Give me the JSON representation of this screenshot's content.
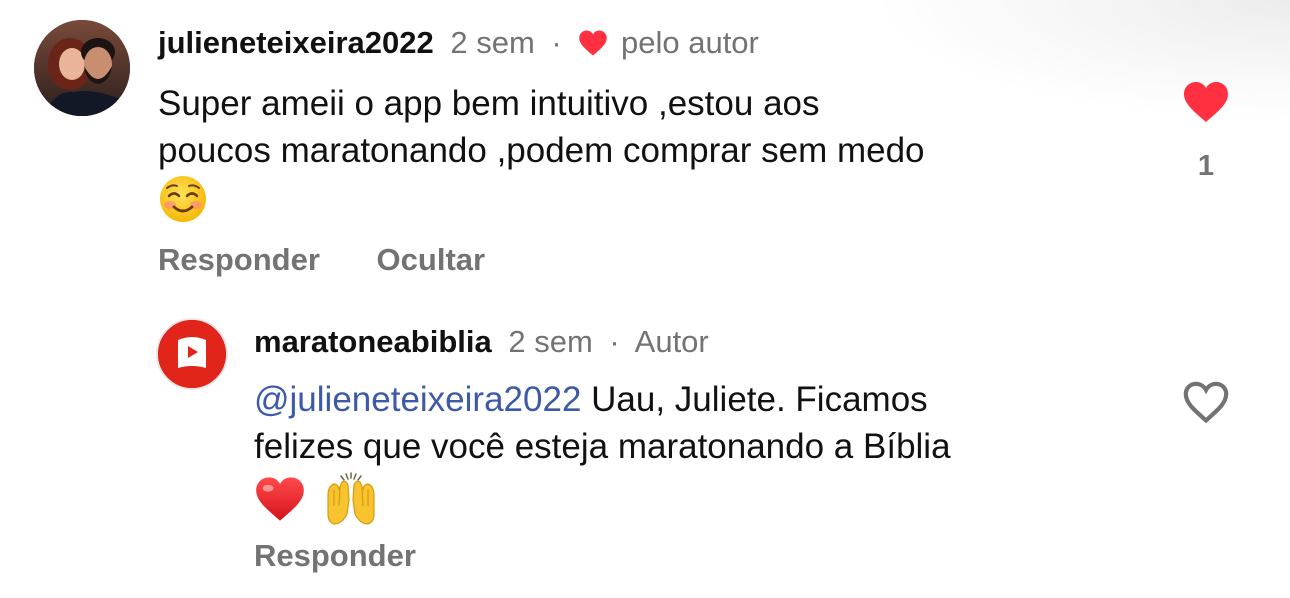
{
  "comments": [
    {
      "username": "julieneteixeira2022",
      "time": "2 sem",
      "separator": "·",
      "liked_by_author_label": "pelo autor",
      "text_line1": "Super ameii o app bem intuitivo ,estou aos",
      "text_line2": "poucos maratonando ,podem comprar sem medo",
      "emoji": "smiling-face-icon",
      "reply_label": "Responder",
      "hide_label": "Ocultar",
      "like_count": "1",
      "liked": true
    }
  ],
  "reply": {
    "username": "maratoneabiblia",
    "time": "2 sem",
    "separator": "·",
    "author_label": "Autor",
    "mention": "@julieneteixeira2022",
    "text_line1_rest": " Uau, Juliete. Ficamos",
    "text_line2": "felizes que você esteja maratonando a Bíblia",
    "emojis": [
      "red-heart-icon",
      "raising-hands-icon"
    ],
    "reply_label": "Responder",
    "liked": false
  },
  "colors": {
    "like_red": "#ff3040",
    "muted": "#737373",
    "mention": "#3d5aa8",
    "brand": "#e1251b"
  }
}
